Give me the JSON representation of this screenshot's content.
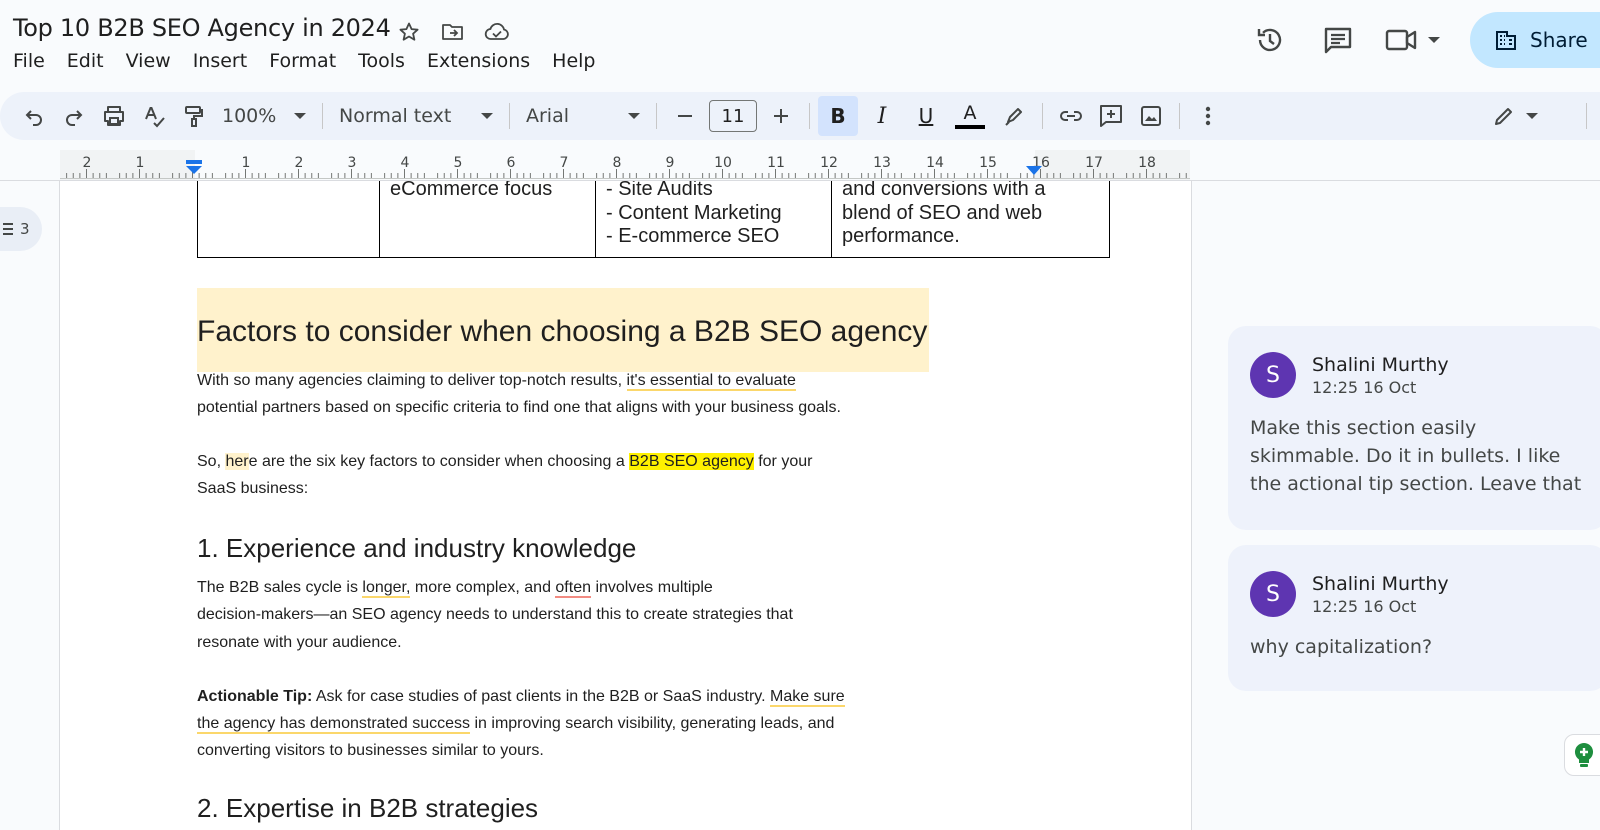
{
  "doc_title": "Top 10 B2B SEO Agency in 2024",
  "menu": [
    "File",
    "Edit",
    "View",
    "Insert",
    "Format",
    "Tools",
    "Extensions",
    "Help"
  ],
  "share_label": "Share",
  "toolbar": {
    "zoom": "100%",
    "style": "Normal text",
    "font": "Arial",
    "font_size": "11",
    "bold_glyph": "B",
    "italic_glyph": "I",
    "underline_glyph": "U",
    "text_color_glyph": "A"
  },
  "ruler": {
    "labels": [
      "2",
      "1",
      "1",
      "2",
      "3",
      "4",
      "5",
      "6",
      "7",
      "8",
      "9",
      "10",
      "11",
      "12",
      "13",
      "14",
      "15",
      "16",
      "17",
      "18"
    ]
  },
  "outline_count": "3",
  "table_row": {
    "col2": [
      "eCommerce focus"
    ],
    "col3": [
      "- Site Audits",
      "- Content Marketing",
      "- E-commerce SEO"
    ],
    "col4": [
      "and conversions with a",
      "blend of SEO and web",
      "performance."
    ]
  },
  "doc": {
    "heading": "Factors to consider when choosing a B2B SEO agency",
    "p1_a": "With so many agencies claiming to deliver top-notch results, ",
    "p1_b": "it's essential to evaluate",
    "p1_c": "potential partners based on specific criteria to find one that aligns with your business goals.",
    "p2_a": "So, ",
    "p2_b": "her",
    "p2_c": "e are the six key factors to consider when choosing a ",
    "p2_d": "B2B SEO agency",
    "p2_e": " for your",
    "p2_f": "SaaS business:",
    "h2_1": "1. Experience and industry knowledge",
    "p3_a": "The B2B sales cycle is ",
    "p3_b": "longer,",
    "p3_c": " more complex, and ",
    "p3_d": "often",
    "p3_e": " involves multiple",
    "p3_f": "decision-makers—an SEO agency needs to understand this to create strategies that",
    "p3_g": "resonate with your audience.",
    "tip_label": "Actionable Tip:",
    "p4_a": " Ask for case studies of past clients in the B2B or SaaS industry. ",
    "p4_b": "Make sure",
    "p4_c": "the agency has demonstrated success",
    "p4_d": " in improving search visibility, generating leads, and",
    "p4_e": "converting visitors to businesses similar to yours.",
    "h2_2": "2. Expertise in B2B strategies"
  },
  "comments": [
    {
      "avatar": "S",
      "author": "Shalini Murthy",
      "time": "12:25 16 Oct",
      "lines": [
        "Make this section easily",
        "skimmable. Do it in bullets. I like",
        "the actional tip section. Leave that"
      ]
    },
    {
      "avatar": "S",
      "author": "Shalini Murthy",
      "time": "12:25 16 Oct",
      "lines": [
        "why capitalization?"
      ]
    }
  ],
  "colors": {
    "accent": "#0b57d0",
    "share_bg": "#c2e7ff",
    "avatar": "#5e35b1",
    "heading_highlight": "#fff2cc",
    "text_highlight": "#fff100",
    "comment_bg": "#eef2fb"
  }
}
